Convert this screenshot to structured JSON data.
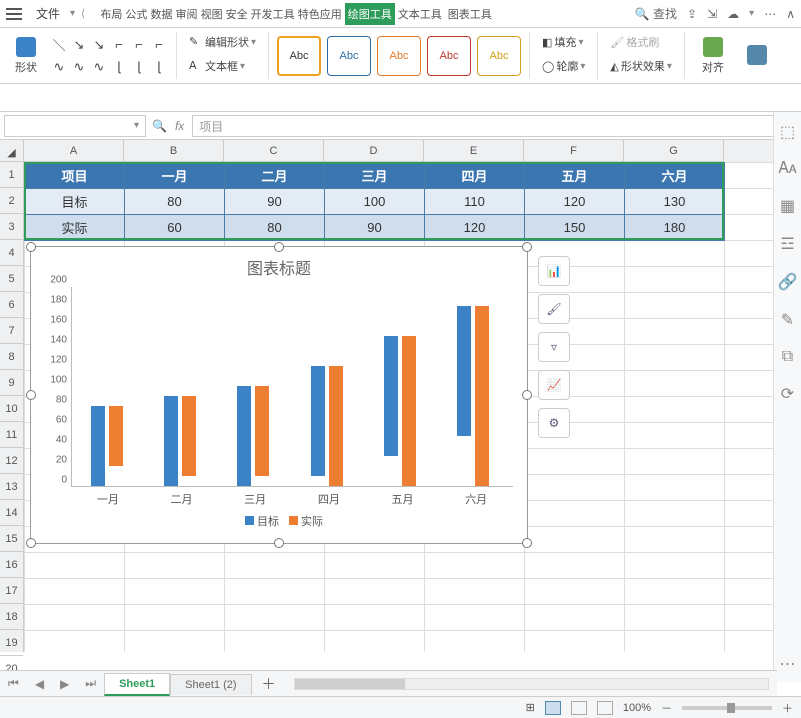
{
  "menu": {
    "file": "文件",
    "tabs_prefix": "布局  公式  数据  审阅  视图  安全  开发工具  特色应用",
    "tab_draw": "绘图工具",
    "tab_text": "文本工具",
    "tab_chart": "图表工具",
    "search": "查找"
  },
  "ribbon": {
    "shape": "形状",
    "edit_shape": "编辑形状",
    "textbox": "文本框",
    "preset": "Abc",
    "fill": "填充",
    "outline": "轮廓",
    "format_painter": "格式刷",
    "shape_effects": "形状效果",
    "align": "对齐"
  },
  "formula_bar": {
    "namebox": "",
    "fx": "fx",
    "content": "项目"
  },
  "columns": [
    "A",
    "B",
    "C",
    "D",
    "E",
    "F",
    "G"
  ],
  "rows_visible": 21,
  "table": {
    "header": [
      "项目",
      "一月",
      "二月",
      "三月",
      "四月",
      "五月",
      "六月"
    ],
    "rows": [
      [
        "目标",
        "80",
        "90",
        "100",
        "110",
        "120",
        "130"
      ],
      [
        "实际",
        "60",
        "80",
        "90",
        "120",
        "150",
        "180"
      ]
    ]
  },
  "chart_data": {
    "type": "bar",
    "title": "图表标题",
    "categories": [
      "一月",
      "二月",
      "三月",
      "四月",
      "五月",
      "六月"
    ],
    "series": [
      {
        "name": "目标",
        "values": [
          80,
          90,
          100,
          110,
          120,
          130
        ],
        "color": "#3b82c7"
      },
      {
        "name": "实际",
        "values": [
          60,
          80,
          90,
          120,
          150,
          180
        ],
        "color": "#ed7d31"
      }
    ],
    "ylim": [
      0,
      200
    ],
    "ytick": 20,
    "xlabel": "",
    "ylabel": ""
  },
  "sheet_tabs": {
    "active": "Sheet1",
    "other": "Sheet1 (2)"
  },
  "status": {
    "zoom": "100%"
  }
}
